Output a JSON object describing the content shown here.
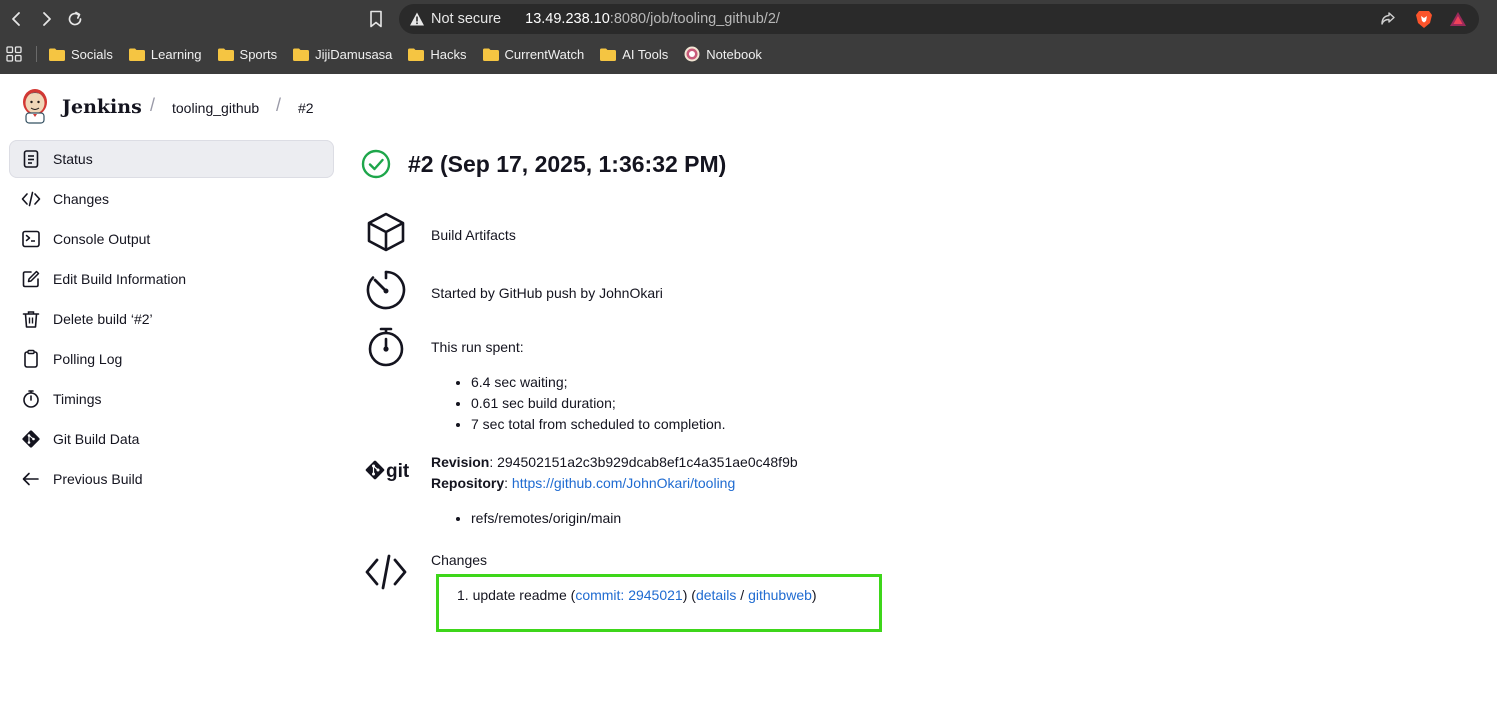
{
  "browser": {
    "url_status": "Not secure",
    "url_host": "13.49.238.10",
    "url_rest": ":8080/job/tooling_github/2/",
    "icons": [
      "back-icon",
      "forward-icon",
      "reload-icon",
      "bookmark-icon",
      "warning-icon",
      "share-icon",
      "brave-icon",
      "rewards-icon",
      "apps-icon"
    ],
    "bookmarks": [
      {
        "label": "Socials",
        "icon": "folder-icon"
      },
      {
        "label": "Learning",
        "icon": "folder-icon"
      },
      {
        "label": "Sports",
        "icon": "folder-icon"
      },
      {
        "label": "JijiDamusasa",
        "icon": "folder-icon"
      },
      {
        "label": "Hacks",
        "icon": "folder-icon"
      },
      {
        "label": "CurrentWatch",
        "icon": "folder-icon"
      },
      {
        "label": "AI Tools",
        "icon": "folder-icon"
      },
      {
        "label": "Notebook",
        "icon": "notebook-icon"
      }
    ]
  },
  "header": {
    "app_title": "Jenkins",
    "breadcrumbs": [
      "tooling_github",
      "#2"
    ]
  },
  "sidebar": {
    "items": [
      {
        "label": "Status",
        "icon": "status-icon",
        "active": true
      },
      {
        "label": "Changes",
        "icon": "code-icon"
      },
      {
        "label": "Console Output",
        "icon": "terminal-icon"
      },
      {
        "label": "Edit Build Information",
        "icon": "edit-icon"
      },
      {
        "label": "Delete build ‘#2’",
        "icon": "trash-icon"
      },
      {
        "label": "Polling Log",
        "icon": "clipboard-icon"
      },
      {
        "label": "Timings",
        "icon": "stopwatch-icon"
      },
      {
        "label": "Git Build Data",
        "icon": "git-icon"
      },
      {
        "label": "Previous Build",
        "icon": "arrow-left-icon"
      }
    ]
  },
  "build": {
    "title": "#2 (Sep 17, 2025, 1:36:32 PM)",
    "status_color": "#1ea64b",
    "artifacts_link": "Build Artifacts",
    "started_by": "Started by GitHub push by JohnOkari",
    "spent_title": "This run spent:",
    "spent_items": [
      "6.4 sec waiting;",
      "0.61 sec build duration;",
      "7 sec total from scheduled to completion."
    ],
    "git": {
      "revision_label": "Revision",
      "revision": ": 294502151a2c3b929dcab8ef1c4a351ae0c48f9b",
      "repository_label": "Repository",
      "repository_sep": ": ",
      "repository_url": "https://github.com/JohnOkari/tooling",
      "branches": [
        "refs/remotes/origin/main"
      ]
    },
    "changes": {
      "title": "Changes",
      "items": [
        {
          "number": "1.",
          "message": "update readme (",
          "commit": "commit: 2945021",
          "mid": ") (",
          "details": "details",
          "sep": " / ",
          "githubweb": "githubweb",
          "end": ")"
        }
      ]
    }
  },
  "colors": {
    "link": "#1f6bd1",
    "highlight": "#3ed61a",
    "chrome": "#3c3c3c"
  }
}
